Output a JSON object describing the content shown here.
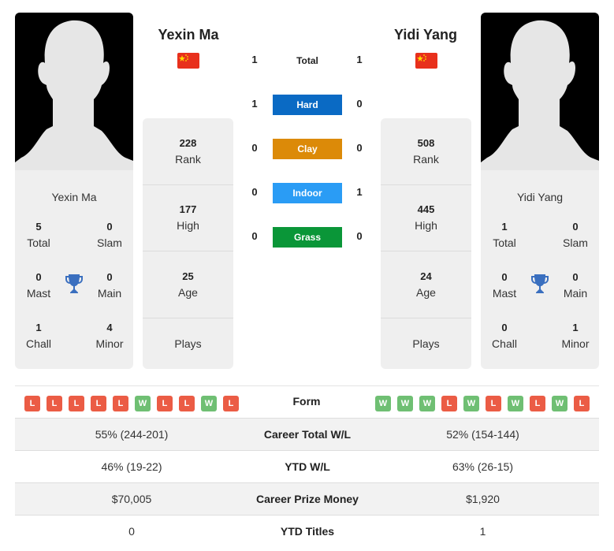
{
  "players": [
    {
      "name": "Yexin Ma",
      "country_flag": "china-flag",
      "card_name": "Yexin Ma",
      "titles": {
        "total": {
          "value": "5",
          "label": "Total"
        },
        "slam": {
          "value": "0",
          "label": "Slam"
        },
        "mast": {
          "value": "0",
          "label": "Mast"
        },
        "main": {
          "value": "0",
          "label": "Main"
        },
        "chall": {
          "value": "1",
          "label": "Chall"
        },
        "minor": {
          "value": "4",
          "label": "Minor"
        }
      },
      "stats": {
        "rank": {
          "value": "228",
          "label": "Rank"
        },
        "high": {
          "value": "177",
          "label": "High"
        },
        "age": {
          "value": "25",
          "label": "Age"
        },
        "plays": {
          "value": "",
          "label": "Plays"
        }
      },
      "form": [
        "L",
        "L",
        "L",
        "L",
        "L",
        "W",
        "L",
        "L",
        "W",
        "L"
      ]
    },
    {
      "name": "Yidi Yang",
      "country_flag": "china-flag",
      "card_name": "Yidi Yang",
      "titles": {
        "total": {
          "value": "1",
          "label": "Total"
        },
        "slam": {
          "value": "0",
          "label": "Slam"
        },
        "mast": {
          "value": "0",
          "label": "Mast"
        },
        "main": {
          "value": "0",
          "label": "Main"
        },
        "chall": {
          "value": "0",
          "label": "Chall"
        },
        "minor": {
          "value": "1",
          "label": "Minor"
        }
      },
      "stats": {
        "rank": {
          "value": "508",
          "label": "Rank"
        },
        "high": {
          "value": "445",
          "label": "High"
        },
        "age": {
          "value": "24",
          "label": "Age"
        },
        "plays": {
          "value": "",
          "label": "Plays"
        }
      },
      "form": [
        "W",
        "W",
        "W",
        "L",
        "W",
        "L",
        "W",
        "L",
        "W",
        "L"
      ]
    }
  ],
  "h2h": [
    {
      "surface": "Total",
      "left": "1",
      "right": "1",
      "color": ""
    },
    {
      "surface": "Hard",
      "left": "1",
      "right": "0",
      "color": "#0a6ac4"
    },
    {
      "surface": "Clay",
      "left": "0",
      "right": "0",
      "color": "#dc8a08"
    },
    {
      "surface": "Indoor",
      "left": "0",
      "right": "1",
      "color": "#2a9cf5"
    },
    {
      "surface": "Grass",
      "left": "0",
      "right": "0",
      "color": "#0a9638"
    }
  ],
  "form_label": "Form",
  "comparison": [
    {
      "label": "Career Total W/L",
      "left": "55% (244-201)",
      "right": "52% (154-144)"
    },
    {
      "label": "YTD W/L",
      "left": "46% (19-22)",
      "right": "63% (26-15)"
    },
    {
      "label": "Career Prize Money",
      "left": "$70,005",
      "right": "$1,920"
    },
    {
      "label": "YTD Titles",
      "left": "0",
      "right": "1"
    }
  ],
  "colors": {
    "win": "#6fbf73",
    "loss": "#eb5c45",
    "trophy": "#3a6fbf"
  }
}
